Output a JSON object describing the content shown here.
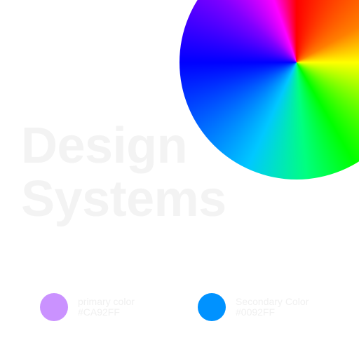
{
  "headline": {
    "line1": "Design",
    "line2": "Systems"
  },
  "color_wheel": {
    "icon": "color-wheel"
  },
  "swatches": {
    "primary": {
      "label": "primary color",
      "hex": "#CA92FF",
      "color": "#CA92FF"
    },
    "secondary": {
      "label": "Secondary Color",
      "hex": "#0092FF",
      "color": "#0092FF"
    }
  }
}
